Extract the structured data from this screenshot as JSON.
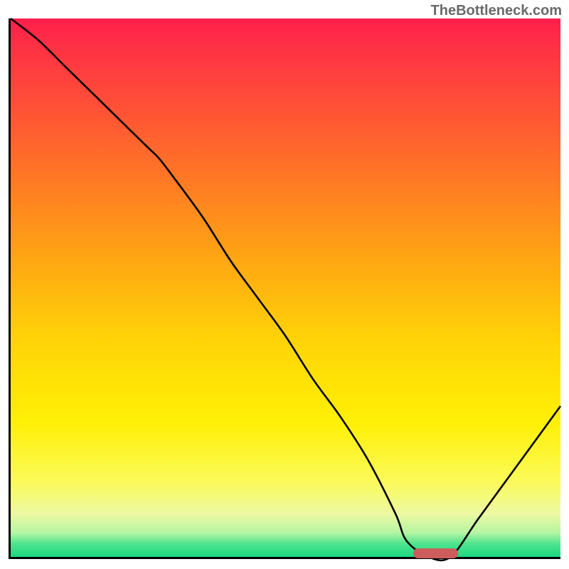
{
  "attribution": "TheBottleneck.com",
  "chart_data": {
    "type": "line",
    "title": "",
    "xlabel": "",
    "ylabel": "",
    "x": [
      0,
      5,
      10,
      15,
      20,
      25,
      27,
      30,
      35,
      40,
      45,
      50,
      55,
      60,
      65,
      70,
      72,
      76,
      80,
      85,
      90,
      95,
      100
    ],
    "values": [
      100,
      96,
      91,
      86,
      81,
      76,
      74,
      70,
      63,
      55,
      48,
      41,
      33,
      26,
      18,
      8,
      3,
      0,
      0,
      7,
      14,
      21,
      28
    ],
    "ylim": [
      0,
      100
    ],
    "xlim": [
      0,
      100
    ],
    "background_gradient": {
      "top": "#ff1e4b",
      "mid": "#ffd407",
      "bottom": "#18d97f"
    },
    "marker": {
      "x_start_pct": 73,
      "x_end_pct": 81,
      "y_pct": 0.5,
      "color": "#cd5c5c"
    }
  }
}
